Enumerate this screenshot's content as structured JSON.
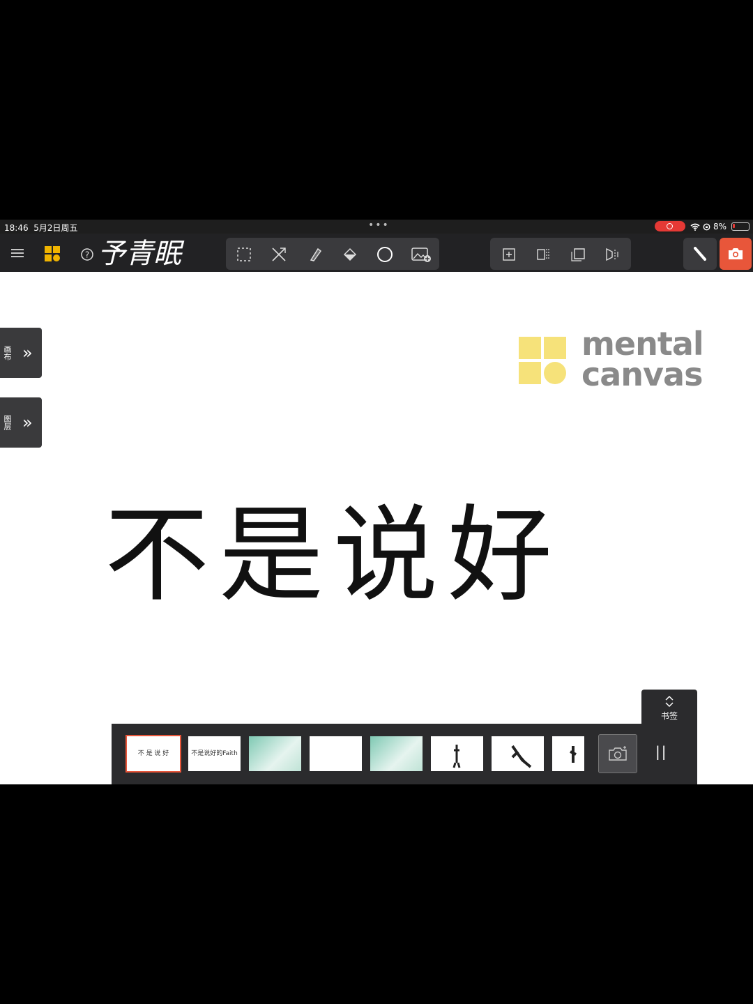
{
  "status_bar": {
    "time": "18:46",
    "date": "5月2日周五",
    "more": "•••",
    "battery": "8%"
  },
  "toolbar": {
    "title_handwriting": "予青眠",
    "colors": {
      "accent": "#f0b400",
      "camera": "#e8563a"
    },
    "icons": [
      "menu-icon",
      "layers-icon",
      "help-icon",
      "select-icon",
      "pencil-x-icon",
      "eraser-icon",
      "fill-icon",
      "circle-icon",
      "insert-image-icon",
      "add-panel-icon",
      "split-panel-icon",
      "rotate-panel-icon",
      "mirror-icon",
      "pen-icon",
      "camera-icon"
    ]
  },
  "side_tabs": [
    {
      "label": "画布",
      "chevron": "»"
    },
    {
      "label": "图层",
      "chevron": "»"
    }
  ],
  "logo": {
    "line1": "mental",
    "line2": "canvas"
  },
  "canvas": {
    "calligraphy": "不是说好"
  },
  "strip": {
    "thumbnails": [
      {
        "label": "不 是 说 好",
        "active": true
      },
      {
        "label": "不是说好的Faith",
        "active": false
      },
      {
        "label": "",
        "active": false
      },
      {
        "label": "",
        "active": false
      },
      {
        "label": "",
        "active": false
      },
      {
        "label": "",
        "active": false
      },
      {
        "label": "",
        "active": false
      },
      {
        "label": "",
        "active": false
      }
    ],
    "bookmark_label": "书签",
    "pause": "||"
  }
}
